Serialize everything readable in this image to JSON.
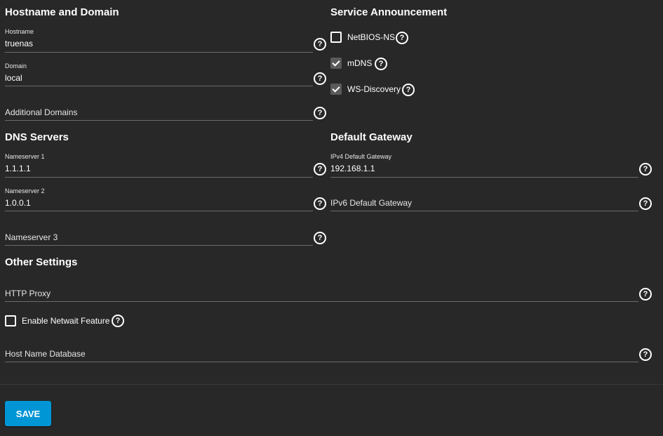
{
  "hostname_domain": {
    "title": "Hostname and Domain",
    "hostname_label": "Hostname",
    "hostname_value": "truenas",
    "domain_label": "Domain",
    "domain_value": "local",
    "additional_domains_placeholder": "Additional Domains"
  },
  "service_announcement": {
    "title": "Service Announcement",
    "items": [
      {
        "label": "NetBIOS-NS",
        "checked": false
      },
      {
        "label": "mDNS",
        "checked": true
      },
      {
        "label": "WS-Discovery",
        "checked": true
      }
    ]
  },
  "dns_servers": {
    "title": "DNS Servers",
    "ns1_label": "Nameserver 1",
    "ns1_value": "1.1.1.1",
    "ns2_label": "Nameserver 2",
    "ns2_value": "1.0.0.1",
    "ns3_placeholder": "Nameserver 3"
  },
  "default_gateway": {
    "title": "Default Gateway",
    "ipv4_label": "IPv4 Default Gateway",
    "ipv4_value": "192.168.1.1",
    "ipv6_placeholder": "IPv6 Default Gateway"
  },
  "other_settings": {
    "title": "Other Settings",
    "http_proxy_placeholder": "HTTP Proxy",
    "netwait_label": "Enable Netwait Feature",
    "netwait_checked": false,
    "host_name_db_placeholder": "Host Name Database"
  },
  "actions": {
    "save_label": "SAVE"
  },
  "icons": {
    "help": "help-circle-icon",
    "checkmark": "checkmark-icon"
  },
  "colors": {
    "background": "#282828",
    "accent": "#0095d5",
    "underline": "#6b6b6b"
  }
}
